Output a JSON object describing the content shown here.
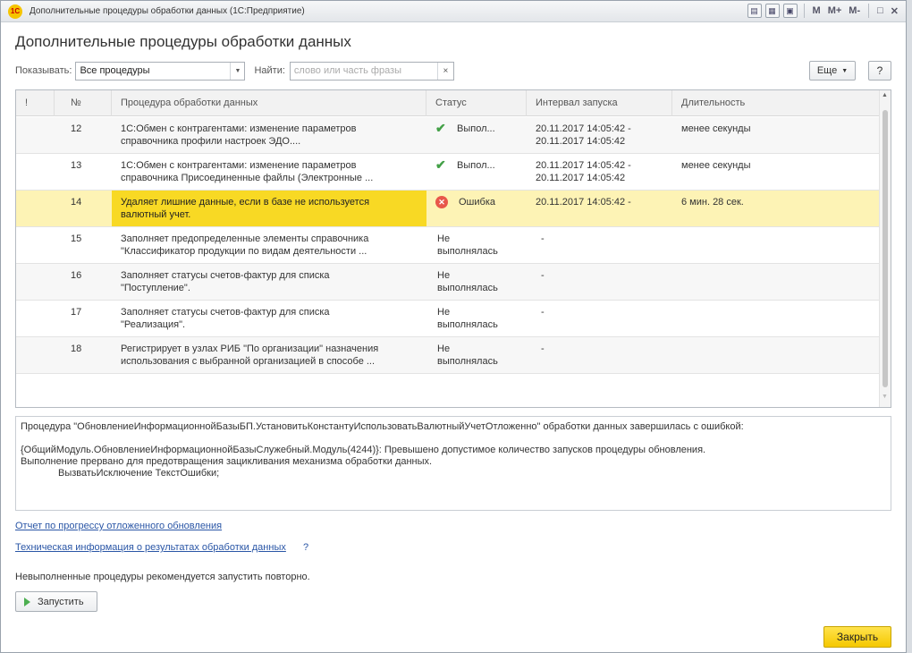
{
  "titlebar": {
    "logo": "1С",
    "title": "Дополнительные процедуры обработки данных  (1С:Предприятие)",
    "controls": [
      "print-icon",
      "table-icon",
      "calendar-icon"
    ],
    "m_labels": [
      "M",
      "M+",
      "M-"
    ],
    "window_controls": [
      "□",
      "✕"
    ]
  },
  "page_title": "Дополнительные процедуры обработки данных",
  "filter": {
    "show_label": "Показывать:",
    "show_value": "Все процедуры",
    "find_label": "Найти:",
    "find_placeholder": "слово или часть фразы",
    "clear": "×",
    "more_label": "Еще",
    "help_label": "?"
  },
  "table": {
    "columns": [
      "!",
      "№",
      "Процедура обработки данных",
      "Статус",
      "Интервал запуска",
      "Длительность"
    ],
    "rows": [
      {
        "num": "12",
        "proc": [
          "1С:Обмен с контрагентами: изменение параметров",
          "справочника профили настроек ЭДО...."
        ],
        "status_icon": "ok",
        "status": [
          "Выпол..."
        ],
        "interval": [
          "20.11.2017 14:05:42 -",
          "20.11.2017 14:05:42"
        ],
        "duration": "менее секунды"
      },
      {
        "num": "13",
        "proc": [
          "1С:Обмен с контрагентами: изменение параметров",
          "справочника Присоединенные файлы (Электронные ..."
        ],
        "status_icon": "ok",
        "status": [
          "Выпол..."
        ],
        "interval": [
          "20.11.2017 14:05:42 -",
          "20.11.2017 14:05:42"
        ],
        "duration": "менее секунды"
      },
      {
        "num": "14",
        "proc": [
          "Удаляет лишние данные, если в базе не используется",
          "валютный учет."
        ],
        "status_icon": "error",
        "status": [
          "Ошибка"
        ],
        "interval": [
          "20.11.2017 14:05:42 -",
          ""
        ],
        "duration": "6 мин. 28 сек."
      },
      {
        "num": "15",
        "proc": [
          "Заполняет предопределенные элементы справочника",
          "\"Классификатор продукции по видам деятельности ..."
        ],
        "status_icon": "",
        "status": [
          "Не",
          "выполнялась"
        ],
        "interval": [
          "-",
          ""
        ],
        "duration": ""
      },
      {
        "num": "16",
        "proc": [
          "Заполняет статусы счетов-фактур для списка",
          "\"Поступление\"."
        ],
        "status_icon": "",
        "status": [
          "Не",
          "выполнялась"
        ],
        "interval": [
          "-",
          ""
        ],
        "duration": ""
      },
      {
        "num": "17",
        "proc": [
          "Заполняет статусы счетов-фактур для списка",
          "\"Реализация\"."
        ],
        "status_icon": "",
        "status": [
          "Не",
          "выполнялась"
        ],
        "interval": [
          "-",
          ""
        ],
        "duration": ""
      },
      {
        "num": "18",
        "proc": [
          "Регистрирует в узлах РИБ \"По организации\" назначения",
          "использования с выбранной организацией в способе ..."
        ],
        "status_icon": "",
        "status": [
          "Не",
          "выполнялась"
        ],
        "interval": [
          "-",
          ""
        ],
        "duration": ""
      }
    ],
    "selected_row": 2
  },
  "message": {
    "line1": "Процедура \"ОбновлениеИнформационнойБазыБП.УстановитьКонстантуИспользоватьВалютныйУчетОтложенно\" обработки данных завершилась с ошибкой:",
    "line2": "{ОбщийМодуль.ОбновлениеИнформационнойБазыСлужебный.Модуль(4244)}: Превышено допустимое количество запусков процедуры обновления.",
    "line3": "Выполнение прервано для предотвращения зацикливания механизма обработки данных.",
    "line4": "ВызватьИсключение ТекстОшибки;"
  },
  "links": {
    "progress_report": "Отчет по прогрессу отложенного обновления",
    "tech_info": "Техническая информация о результатах обработки данных",
    "tech_info_help": "?"
  },
  "hint": "Невыполненные процедуры рекомендуется запустить повторно.",
  "buttons": {
    "run": "Запустить",
    "close": "Закрыть"
  },
  "colors": {
    "selected_row": "#fdf3b5",
    "selected_cell": "#f8d924",
    "close_button": "#f5c800",
    "ok": "#43a047",
    "error": "#e8574a",
    "link": "#2a56a6"
  }
}
